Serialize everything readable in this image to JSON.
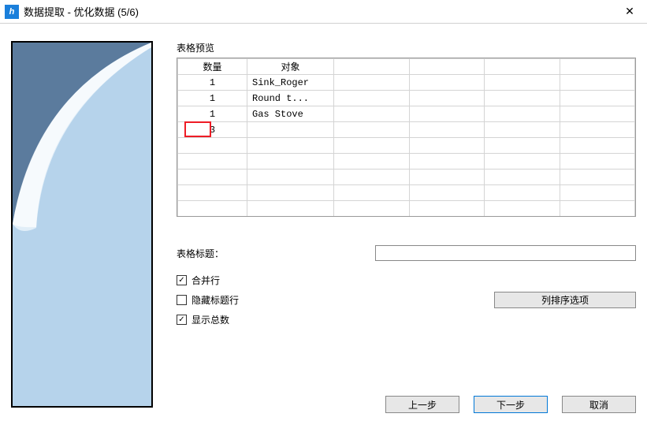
{
  "window": {
    "icon_letter": "h",
    "title": "数据提取 - 优化数据 (5/6)",
    "close": "✕"
  },
  "table": {
    "preview_label": "表格预览",
    "headers": {
      "qty": "数量",
      "obj": "对象"
    },
    "rows": [
      {
        "qty": "1",
        "obj": "Sink_Roger"
      },
      {
        "qty": "1",
        "obj": "Round t..."
      },
      {
        "qty": "1",
        "obj": "Gas Stove"
      }
    ],
    "total": {
      "qty": "3",
      "obj": ""
    }
  },
  "form": {
    "title_label": "表格标题：",
    "title_value": ""
  },
  "checks": {
    "merge_rows": {
      "label": "合并行",
      "checked": true
    },
    "hide_header": {
      "label": "隐藏标题行",
      "checked": false
    },
    "show_total": {
      "label": "显示总数",
      "checked": true
    }
  },
  "sort_button": "列排序选项",
  "buttons": {
    "prev": "上一步",
    "next": "下一步",
    "cancel": "取消"
  }
}
